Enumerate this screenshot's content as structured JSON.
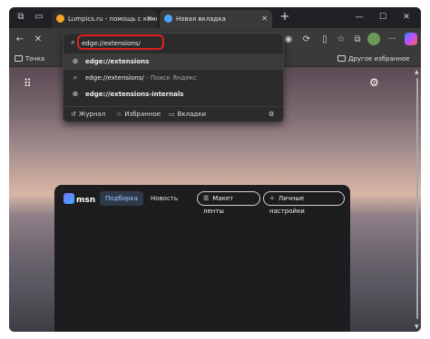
{
  "tabs": [
    {
      "label": "Lumpics.ru - помощь с компьют",
      "favicon_color": "#f5a623"
    },
    {
      "label": "Новая вкладка",
      "favicon_color": "#4da3ff"
    }
  ],
  "address_bar": {
    "value": "edge://extensions/"
  },
  "suggestions": [
    {
      "icon": "globe-icon",
      "text": "edge://extensions",
      "hint": ""
    },
    {
      "icon": "search-icon",
      "text": "edge://extensions/",
      "hint": " - Поиск Яндекс"
    },
    {
      "icon": "globe-icon",
      "text": "edge://extensions-internals",
      "hint": ""
    }
  ],
  "dropdown_footer": {
    "history": "Журнал",
    "favorites": "Избранное",
    "tabs": "Вкладки"
  },
  "bookmarks": {
    "item1": "Точка",
    "other": "Другое избранное"
  },
  "msn": {
    "logo": "msn",
    "tab_active": "Подборка",
    "tab_news": "Новость",
    "feed_layout": "Макет ленты",
    "personal_settings": "Личные настройки"
  },
  "colors": {
    "highlight_box": "#e02020",
    "msn_active_tab": "#9ccaff"
  }
}
